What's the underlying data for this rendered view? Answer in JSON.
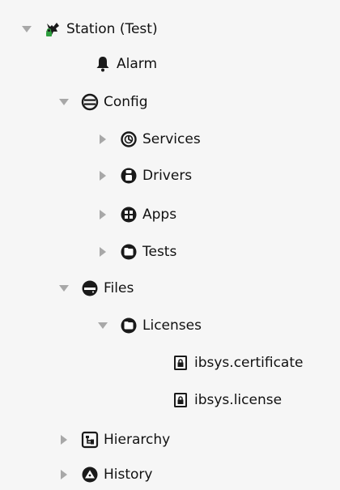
{
  "tree": {
    "station": {
      "label": "Station (Test)",
      "icon": "station-icon",
      "state": "expanded"
    },
    "alarm": {
      "label": "Alarm",
      "icon": "bell-icon"
    },
    "config": {
      "label": "Config",
      "icon": "database-icon",
      "state": "expanded"
    },
    "services": {
      "label": "Services",
      "icon": "services-icon",
      "state": "collapsed"
    },
    "drivers": {
      "label": "Drivers",
      "icon": "drivers-icon",
      "state": "collapsed"
    },
    "apps": {
      "label": "Apps",
      "icon": "apps-icon",
      "state": "collapsed"
    },
    "tests": {
      "label": "Tests",
      "icon": "folder-icon",
      "state": "collapsed"
    },
    "files": {
      "label": "Files",
      "icon": "drive-icon",
      "state": "expanded"
    },
    "licenses": {
      "label": "Licenses",
      "icon": "folder-icon",
      "state": "expanded"
    },
    "certificate": {
      "label": "ibsys.certificate",
      "icon": "file-lock-icon"
    },
    "license": {
      "label": "ibsys.license",
      "icon": "file-lock-icon"
    },
    "hierarchy": {
      "label": "Hierarchy",
      "icon": "hierarchy-icon",
      "state": "collapsed"
    },
    "history": {
      "label": "History",
      "icon": "history-icon",
      "state": "collapsed"
    }
  },
  "colors": {
    "toggle": "#a8a8a8",
    "icon": "#1a1a1a",
    "station_green": "#2e9e3e",
    "background": "#f6f6f6"
  }
}
